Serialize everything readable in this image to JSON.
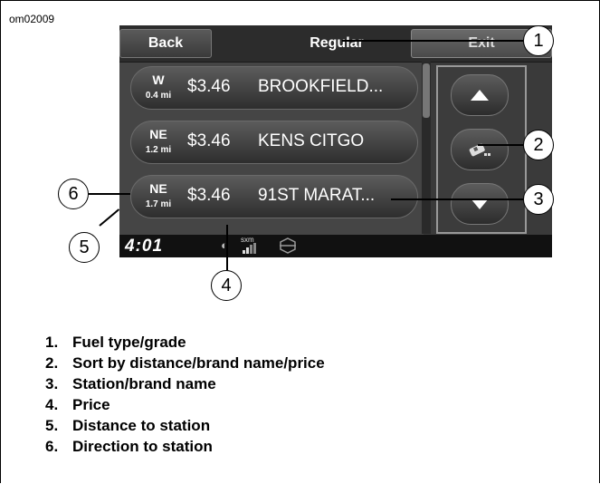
{
  "figure_id": "om02009",
  "screen": {
    "back_label": "Back",
    "title": "Regular",
    "exit_label": "Exit",
    "stations": [
      {
        "direction": "W",
        "distance": "0.4 mi",
        "price": "$3.46",
        "name": "BROOKFIELD..."
      },
      {
        "direction": "NE",
        "distance": "1.2 mi",
        "price": "$3.46",
        "name": "KENS CITGO"
      },
      {
        "direction": "NE",
        "distance": "1.7 mi",
        "price": "$3.46",
        "name": "91ST MARAT..."
      }
    ],
    "status": {
      "clock": "4:01",
      "sxm_label": "sxm"
    }
  },
  "callouts": [
    "1",
    "2",
    "3",
    "4",
    "5",
    "6"
  ],
  "legend": [
    {
      "num": "1.",
      "text": "Fuel type/grade"
    },
    {
      "num": "2.",
      "text": "Sort by distance/brand name/price"
    },
    {
      "num": "3.",
      "text": "Station/brand name"
    },
    {
      "num": "4.",
      "text": "Price"
    },
    {
      "num": "5.",
      "text": "Distance to station"
    },
    {
      "num": "6.",
      "text": "Direction to station"
    }
  ]
}
